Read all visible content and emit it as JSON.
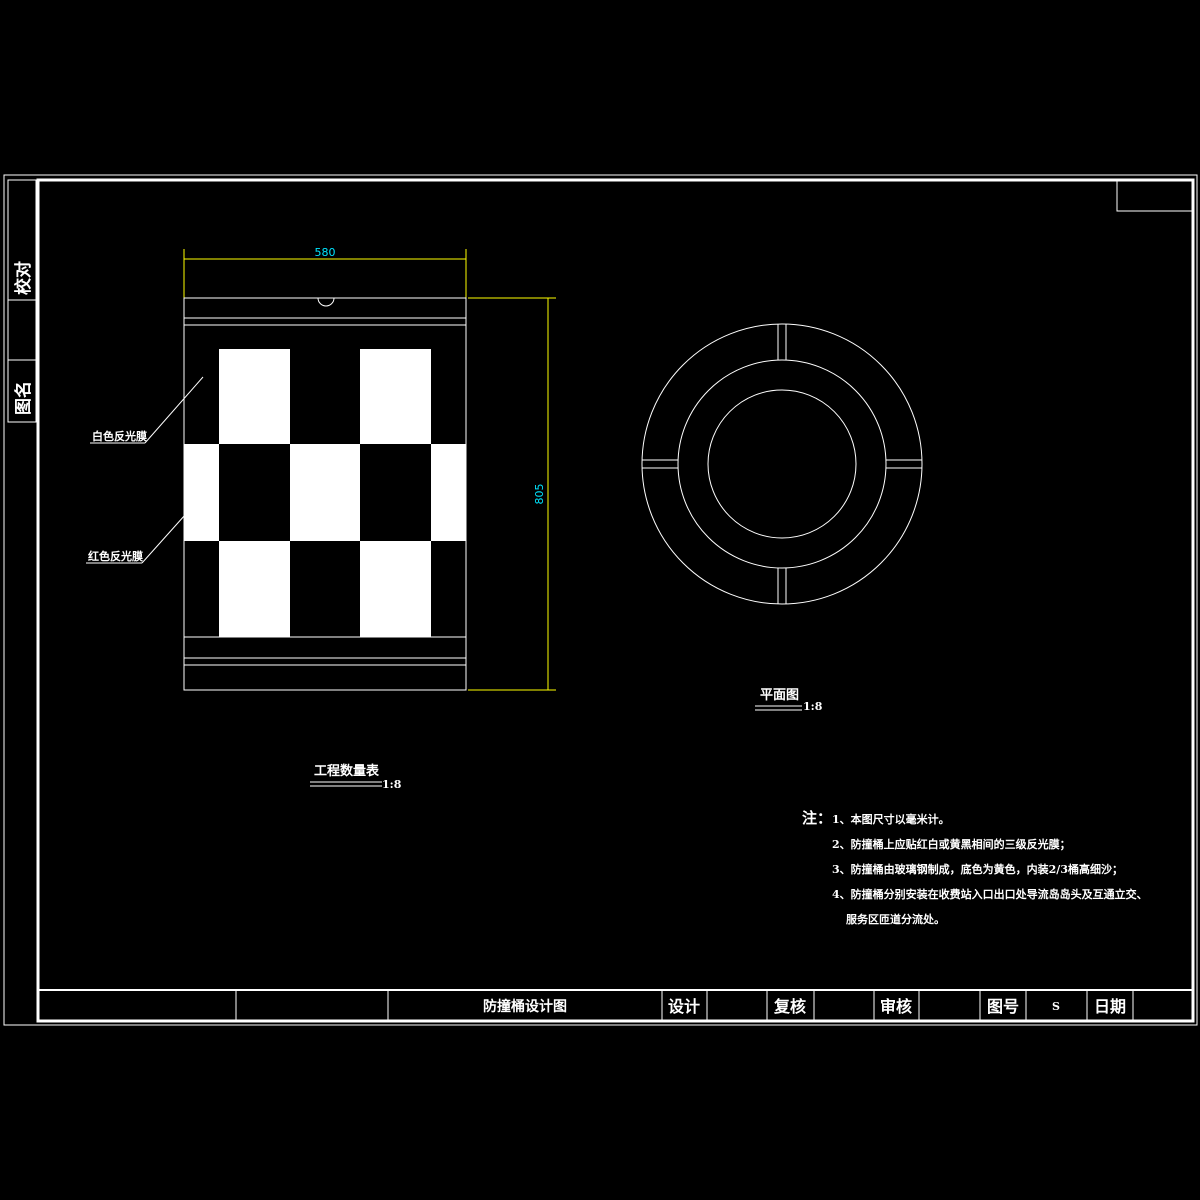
{
  "side_labels": {
    "check": "校对",
    "drawing_name": "图名"
  },
  "elevation": {
    "width_dim": "580",
    "height_dim": "805",
    "white_film_label": "白色反光膜",
    "red_film_label": "红色反光膜",
    "title": "工程数量表",
    "scale": "1:8"
  },
  "plan": {
    "title": "平面图",
    "scale": "1:8"
  },
  "notes": {
    "heading": "注：",
    "items": [
      "1、本图尺寸以毫米计。",
      "2、防撞桶上应贴红白或黄黑相间的三级反光膜；",
      "3、防撞桶由玻璃钢制成，底色为黄色，内装2/3桶高细沙；",
      "4、防撞桶分别安装在收费站入口出口处导流岛岛头及互通立交、",
      "服务区匝道分流处。"
    ]
  },
  "title_block": {
    "drawing_title": "防撞桶设计图",
    "design": "设计",
    "review": "复核",
    "approve": "审核",
    "drawing_no_label": "图号",
    "drawing_no": "S",
    "date": "日期"
  },
  "colors": {
    "line": "#ffffff",
    "dimension": "#ffff00",
    "dimension_text": "#00e5ff",
    "background": "#000000"
  }
}
